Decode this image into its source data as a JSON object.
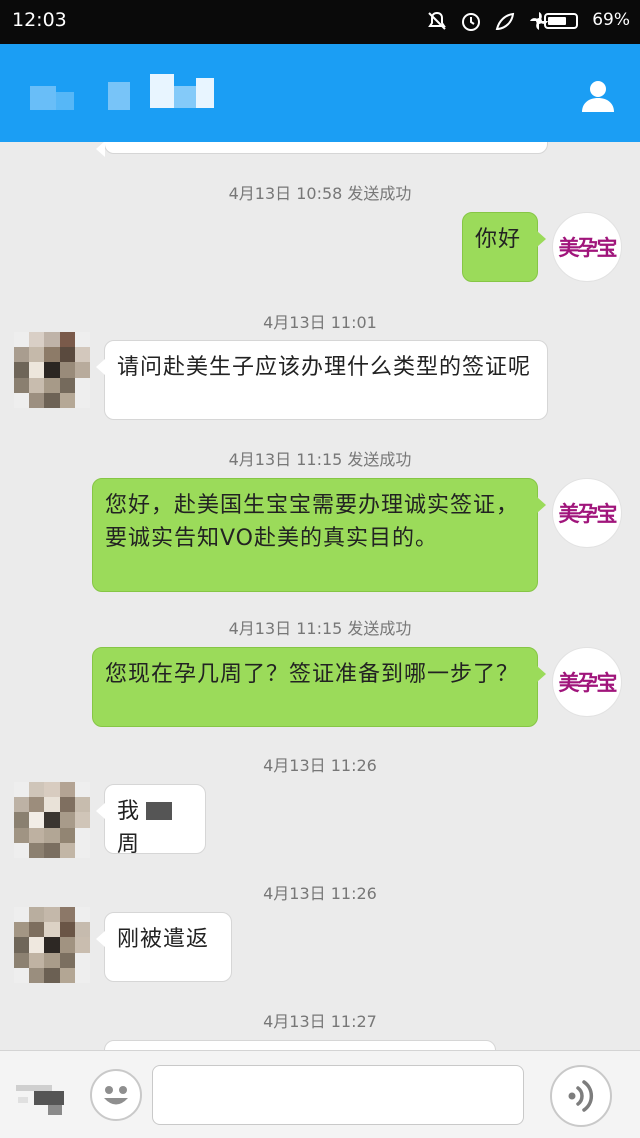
{
  "status_bar": {
    "time": "12:03",
    "battery_percent": "69%",
    "battery_level": 0.69,
    "icons": [
      "mute-icon",
      "alarm-icon",
      "leaf-icon",
      "fan-icon",
      "battery-icon"
    ]
  },
  "header": {
    "contact_name": "",
    "profile_icon": "person-icon",
    "color": "#1b9ef4"
  },
  "brand_avatar": {
    "logo_text": "美孕宝"
  },
  "messages": [
    {
      "stamp": "4月13日 10:58 发送成功"
    },
    {
      "text": "你好"
    },
    {
      "stamp": "4月13日 11:01"
    },
    {
      "text": "请问赴美生子应该办理什么类型的签证呢"
    },
    {
      "stamp": "4月13日 11:15 发送成功"
    },
    {
      "text": "您好，赴美国生宝宝需要办理诚实签证，要诚实告知VO赴美的真实目的。"
    },
    {
      "stamp": "4月13日 11:15 发送成功"
    },
    {
      "text": "您现在孕几周了？签证准备到哪一步了？"
    },
    {
      "stamp": "4月13日 11:26"
    },
    {
      "text_before": "我",
      "text_after": "周"
    },
    {
      "stamp": "4月13日 11:26"
    },
    {
      "text": "刚被遣返"
    },
    {
      "stamp": "4月13日 11:27"
    }
  ],
  "colors": {
    "outgoing_bubble": "#9bdb5a",
    "incoming_bubble": "#ffffff",
    "chat_background": "#ebebeb"
  },
  "input_bar": {
    "value": "",
    "icons": [
      "keyboard-icon",
      "emoji-icon",
      "voice-icon"
    ]
  }
}
